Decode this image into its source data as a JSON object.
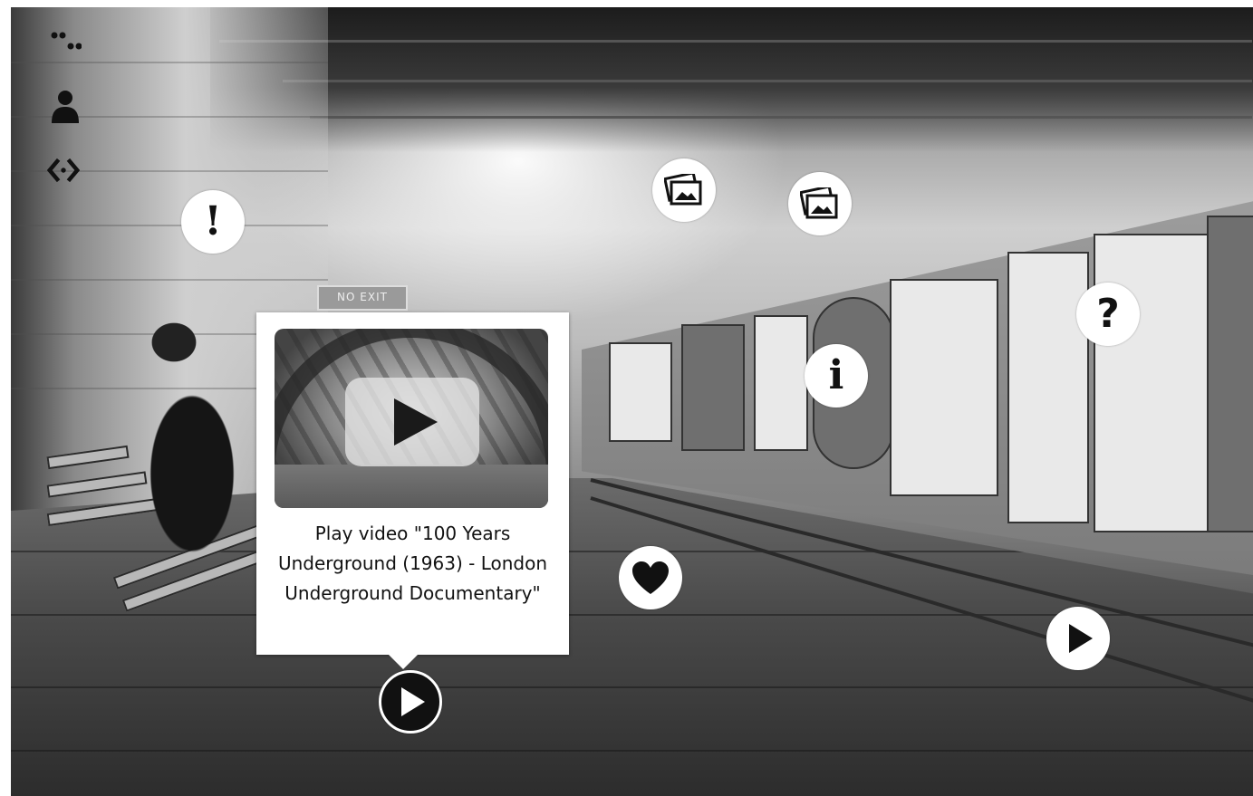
{
  "scene": {
    "sign": "NO EXIT"
  },
  "toolbar": {
    "items": [
      {
        "icon": "dots-grid-icon"
      },
      {
        "icon": "user-icon"
      },
      {
        "icon": "code-brackets-icon"
      }
    ]
  },
  "hotspots": {
    "alert": {
      "icon": "exclamation-icon",
      "glyph": "!"
    },
    "gallery_1": {
      "icon": "gallery-icon"
    },
    "gallery_2": {
      "icon": "gallery-icon"
    },
    "info": {
      "icon": "info-icon",
      "glyph": "i"
    },
    "question": {
      "icon": "question-icon",
      "glyph": "?"
    },
    "favorite": {
      "icon": "heart-icon"
    },
    "play_right": {
      "icon": "play-icon"
    },
    "play_active": {
      "icon": "play-icon"
    }
  },
  "tooltip": {
    "text": "Play video \"100 Years Underground (1963) - London Underground Documentary\""
  },
  "colors": {
    "hotspot_bg": "#ffffff",
    "active_hotspot_bg": "#111111",
    "icon": "#111111"
  }
}
